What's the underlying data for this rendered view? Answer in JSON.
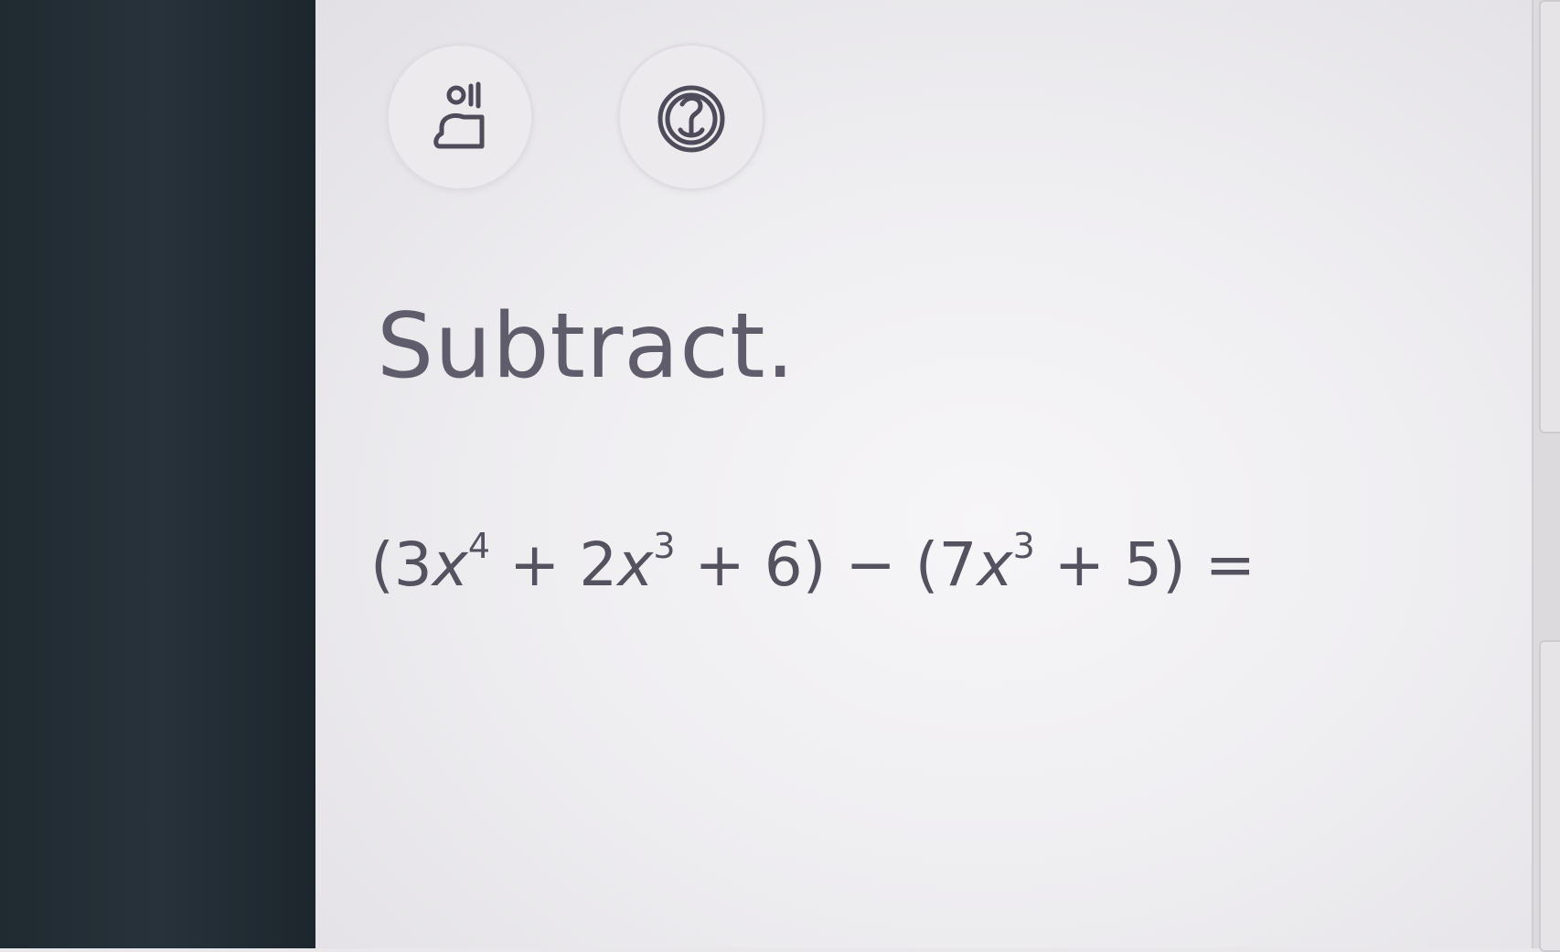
{
  "toolbar": {
    "icons": [
      {
        "name": "audio-speaker-icon"
      },
      {
        "name": "translate-language-icon"
      }
    ]
  },
  "question": {
    "instruction": "Subtract.",
    "expression": {
      "open_paren_1": "(",
      "coef_1": "3",
      "var_1": "x",
      "exp_1": "4",
      "op_1": " + ",
      "coef_2": "2",
      "var_2": "x",
      "exp_2": "3",
      "op_2": " + ",
      "const_1": "6",
      "close_paren_1": ")",
      "minus": " − ",
      "open_paren_2": "(",
      "coef_3": "7",
      "var_3": "x",
      "exp_3": "3",
      "op_3": " + ",
      "const_2": "5",
      "close_paren_2": ")",
      "equals": " ="
    }
  },
  "colors": {
    "text": "#5f5c6b",
    "background": "#f2f1f3",
    "bezel": "#232d34",
    "icon_stroke": "#4e4b5a"
  }
}
